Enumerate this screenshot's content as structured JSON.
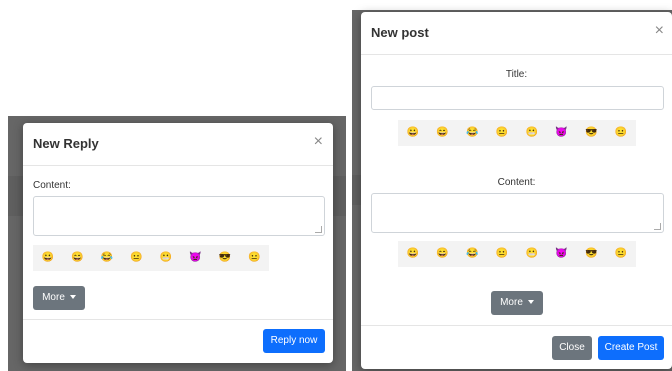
{
  "reply_modal": {
    "title": "New Reply",
    "close_glyph": "×",
    "content_label": "Content:",
    "emojis": [
      "😀",
      "😄",
      "😂",
      "😐",
      "😬",
      "👿",
      "😎",
      "😐"
    ],
    "more_label": "More",
    "submit_label": "Reply now"
  },
  "post_modal": {
    "title": "New post",
    "close_glyph": "×",
    "title_label": "Title:",
    "content_label": "Content:",
    "emojis_title": [
      "😀",
      "😄",
      "😂",
      "😐",
      "😬",
      "👿",
      "😎",
      "😐"
    ],
    "emojis_content": [
      "😀",
      "😄",
      "😂",
      "😐",
      "😬",
      "👿",
      "😎",
      "😐"
    ],
    "more_label": "More",
    "close_label": "Close",
    "create_label": "Create Post"
  }
}
